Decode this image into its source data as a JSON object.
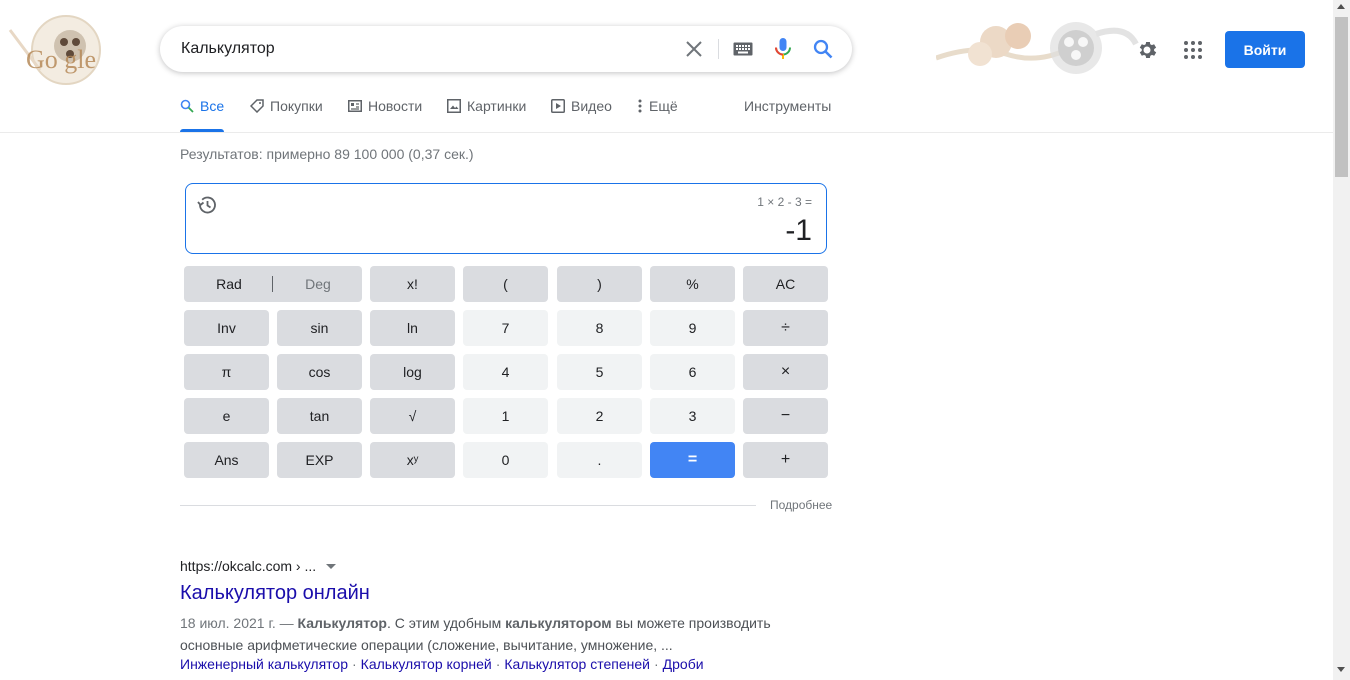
{
  "logo": {
    "icon": "google-doodle-logo"
  },
  "search": {
    "value": "Калькулятор",
    "icons": [
      "close-icon",
      "keyboard-icon",
      "microphone-icon",
      "search-icon"
    ]
  },
  "header": {
    "sign_in": "Войти",
    "settings_icon": "gear-icon",
    "apps_icon": "apps-grid-icon"
  },
  "tabs": [
    {
      "label": "Все",
      "icon": "search-icon",
      "active": true
    },
    {
      "label": "Покупки",
      "icon": "tag-icon"
    },
    {
      "label": "Новости",
      "icon": "newspaper-icon"
    },
    {
      "label": "Картинки",
      "icon": "image-icon"
    },
    {
      "label": "Видео",
      "icon": "play-icon"
    },
    {
      "label": "Ещё",
      "icon": "more-vert-icon"
    }
  ],
  "tools_label": "Инструменты",
  "result_stats": "Результатов: примерно 89 100 000 (0,37 сек.)",
  "calculator": {
    "expression": "1 × 2 - 3 =",
    "result": "-1",
    "rad": "Rad",
    "deg": "Deg",
    "rows": [
      [
        [
          "x!",
          "fn"
        ],
        [
          "(",
          "fn"
        ],
        [
          ")",
          "fn"
        ],
        [
          "%",
          "fn"
        ],
        [
          "AC",
          "fn"
        ]
      ],
      [
        [
          "Inv",
          "fn"
        ],
        [
          "sin",
          "fn"
        ],
        [
          "ln",
          "fn"
        ],
        [
          "7",
          "num"
        ],
        [
          "8",
          "num"
        ],
        [
          "9",
          "num"
        ],
        [
          "÷",
          "fn"
        ]
      ],
      [
        [
          "π",
          "fn"
        ],
        [
          "cos",
          "fn"
        ],
        [
          "log",
          "fn"
        ],
        [
          "4",
          "num"
        ],
        [
          "5",
          "num"
        ],
        [
          "6",
          "num"
        ],
        [
          "×",
          "fn"
        ]
      ],
      [
        [
          "e",
          "fn"
        ],
        [
          "tan",
          "fn"
        ],
        [
          "√",
          "fn"
        ],
        [
          "1",
          "num"
        ],
        [
          "2",
          "num"
        ],
        [
          "3",
          "num"
        ],
        [
          "−",
          "fn"
        ]
      ],
      [
        [
          "Ans",
          "fn"
        ],
        [
          "EXP",
          "fn"
        ],
        [
          "xʸ",
          "fn"
        ],
        [
          "0",
          "num"
        ],
        [
          ".",
          "num"
        ],
        [
          "=",
          "eq"
        ],
        [
          "+",
          "fn"
        ]
      ]
    ],
    "more": "Подробнее"
  },
  "result": {
    "url": "https://okcalc.com › ...",
    "title": "Калькулятор онлайн",
    "date": "18 июл. 2021 г. —",
    "snippet_parts": [
      {
        "text": "Калькулятор",
        "bold": true
      },
      {
        "text": ". С этим удобным ",
        "bold": false
      },
      {
        "text": "калькулятором",
        "bold": true
      },
      {
        "text": " вы можете производить основные арифметические операции (сложение, вычитание, умножение, ...",
        "bold": false
      }
    ],
    "sitelinks": [
      "Инженерный калькулятор",
      "Калькулятор корней",
      "Калькулятор степеней",
      "Дроби"
    ]
  },
  "colors": {
    "accent": "#1a73e8",
    "link": "#1a0dab",
    "equals_key": "#4285f4",
    "fn_key": "#dadce0",
    "num_key": "#f1f3f4"
  }
}
